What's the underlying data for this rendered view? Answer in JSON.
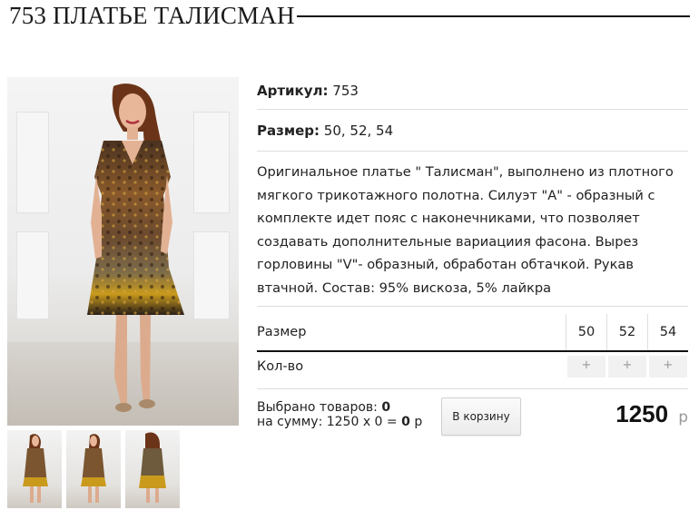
{
  "page": {
    "title": "753 ПЛАТЬЕ ТАЛИСМАН"
  },
  "specs": {
    "article_label": "Артикул:",
    "article_value": "753",
    "size_label": "Размер:",
    "size_value": "50, 52, 54",
    "description": "Оригинальное платье \" Талисман\",  выполнено из плотного мягкого трикотажного полотна. Силуэт \"А\" - образный с комплекте идет пояс с наконечниками, что позволяет создавать дополнительные вариациия фасона. Вырез горловины \"V\"- образный, обработан обтачкой. Рукав втачной. Состав: 95% вискоза, 5% лайкра"
  },
  "size_table": {
    "size_header": "Размер",
    "qty_header": "Кол-во",
    "sizes": [
      "50",
      "52",
      "54"
    ],
    "plus_label": "+"
  },
  "order": {
    "selected_label": "Выбрано товаров:",
    "selected_count": "0",
    "sum_label": "на сумму: 1250 x 0 =",
    "sum_value": "0",
    "sum_currency": "р",
    "cart_button": "В корзину",
    "price": "1250",
    "price_currency": "р"
  },
  "images": {
    "main": "dress-photo",
    "thumbs": [
      "thumb-front",
      "thumb-side",
      "thumb-back"
    ]
  },
  "colors": {
    "text": "#222222",
    "divider": "#dedede",
    "button_bg": "#f1f1f1",
    "currency": "#999999"
  }
}
